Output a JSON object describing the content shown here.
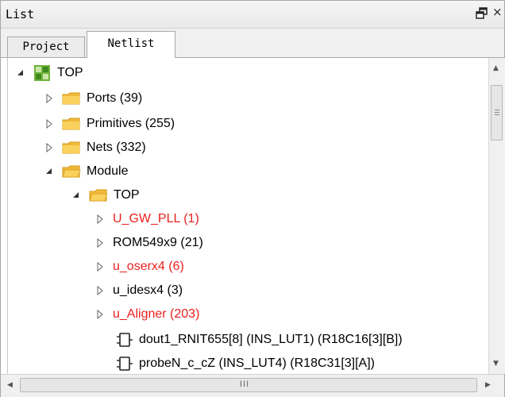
{
  "panel": {
    "title": "List",
    "float_icon": "restore-icon",
    "close_label": "×"
  },
  "tabs": [
    {
      "label": "Project"
    },
    {
      "label": "Netlist",
      "active": true
    }
  ],
  "tree": {
    "top": "TOP",
    "ports": "Ports (39)",
    "primitives": "Primitives (255)",
    "nets": "Nets (332)",
    "module": "Module",
    "module_top": "TOP",
    "children": [
      {
        "label": "U_GW_PLL  (1)",
        "color": "#e8201e"
      },
      {
        "label": "ROM549x9  (21)",
        "color": "#000000"
      },
      {
        "label": "u_oserx4  (6)",
        "color": "#e8201e"
      },
      {
        "label": "u_idesx4  (3)",
        "color": "#000000"
      },
      {
        "label": "u_Aligner  (203)",
        "color": "#e8201e"
      }
    ],
    "instances": [
      {
        "label": "dout1_RNIT655[8]  (INS_LUT1)  (R18C16[3][B])"
      },
      {
        "label": "probeN_c_cZ  (INS_LUT4)  (R18C31[3][A])"
      }
    ]
  },
  "scrollbars": {
    "horizontal_grip": "III"
  }
}
